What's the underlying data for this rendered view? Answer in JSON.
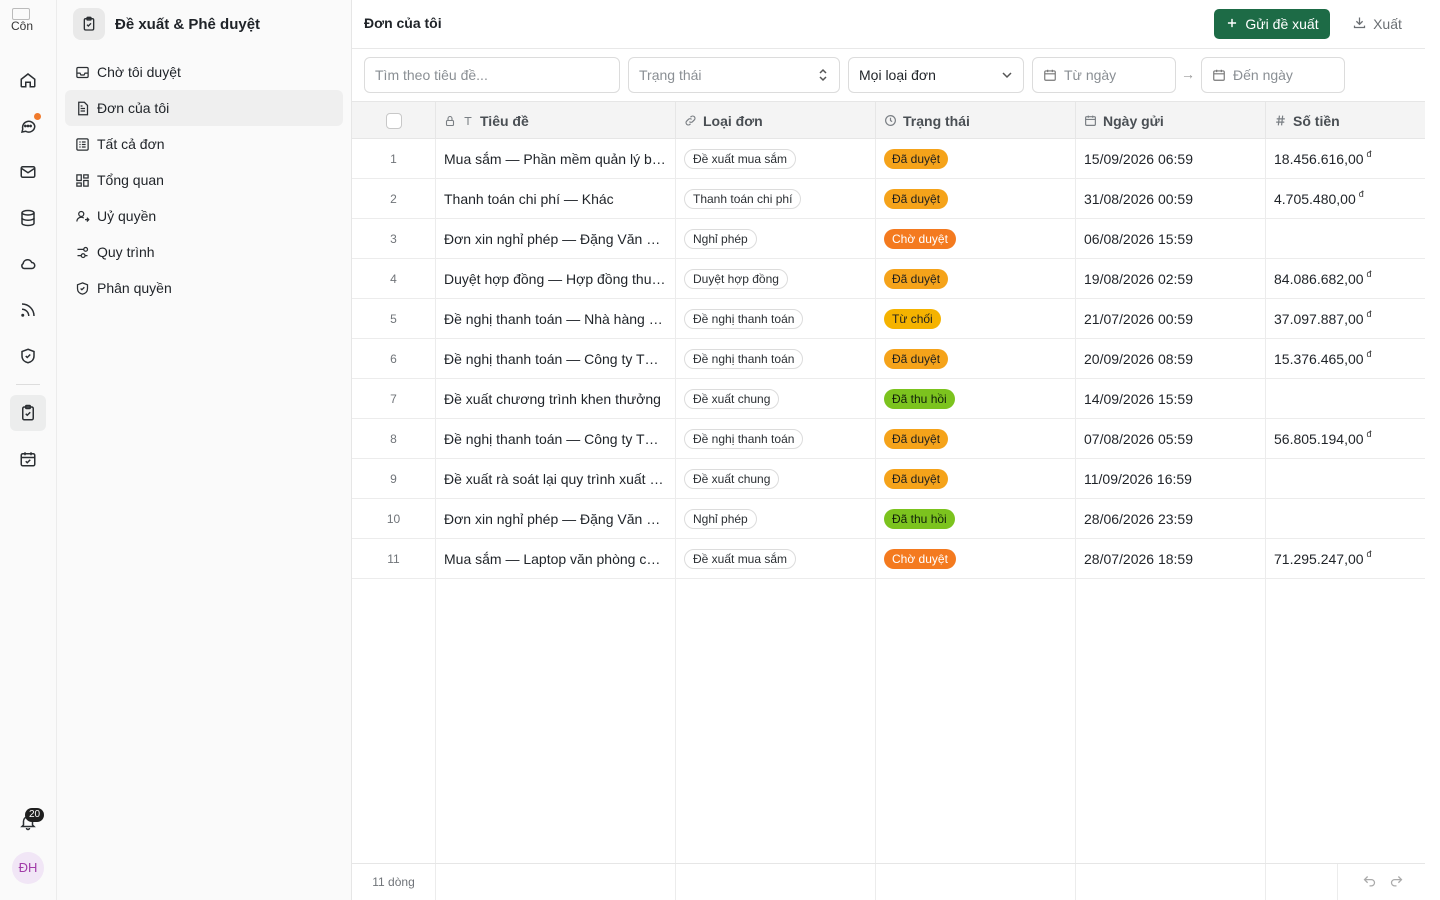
{
  "rail": {
    "logo_text": "Côn",
    "notification_count": "20",
    "avatar_initials": "ĐH"
  },
  "sidebar": {
    "title": "Đề xuất & Phê duyệt",
    "items": [
      {
        "label": "Chờ tôi duyệt",
        "icon": "inbox-icon"
      },
      {
        "label": "Đơn của tôi",
        "icon": "document-icon"
      },
      {
        "label": "Tất cả đơn",
        "icon": "list-icon"
      },
      {
        "label": "Tổng quan",
        "icon": "dashboard-icon"
      },
      {
        "label": "Uỷ quyền",
        "icon": "user-delegate-icon"
      },
      {
        "label": "Quy trình",
        "icon": "workflow-icon"
      },
      {
        "label": "Phân quyền",
        "icon": "shield-icon"
      }
    ],
    "active_index": 1
  },
  "header": {
    "title": "Đơn của tôi",
    "submit_label": "Gửi đề xuất",
    "export_label": "Xuất"
  },
  "filters": {
    "search_placeholder": "Tìm theo tiêu đề...",
    "status_placeholder": "Trạng thái",
    "type_value": "Mọi loại đơn",
    "from_placeholder": "Từ ngày",
    "to_placeholder": "Đến ngày",
    "range_arrow": "→"
  },
  "table": {
    "columns": [
      "Tiêu đề",
      "Loại đơn",
      "Trạng thái",
      "Ngày gửi",
      "Số tiền"
    ],
    "currency_symbol": "đ",
    "rows": [
      {
        "no": "1",
        "title": "Mua sắm — Phần mềm quản lý bán hàng",
        "type": "Đề xuất mua sắm",
        "status": "Đã duyệt",
        "status_kind": "approved",
        "date": "15/09/2026 06:59",
        "amount": "18.456.616,00"
      },
      {
        "no": "2",
        "title": "Thanh toán chi phí — Khác",
        "type": "Thanh toán chi phí",
        "status": "Đã duyệt",
        "status_kind": "approved",
        "date": "31/08/2026 00:59",
        "amount": "4.705.480,00"
      },
      {
        "no": "3",
        "title": "Đơn xin nghỉ phép — Đặng Văn Hùng",
        "type": "Nghỉ phép",
        "status": "Chờ duyệt",
        "status_kind": "pending",
        "date": "06/08/2026 15:59",
        "amount": ""
      },
      {
        "no": "4",
        "title": "Duyệt hợp đồng — Hợp đồng thuê văn phòng",
        "type": "Duyệt hợp đồng",
        "status": "Đã duyệt",
        "status_kind": "approved",
        "date": "19/08/2026 02:59",
        "amount": "84.086.682,00"
      },
      {
        "no": "5",
        "title": "Đề nghị thanh toán — Nhà hàng tiệc",
        "type": "Đề nghị thanh toán",
        "status": "Từ chối",
        "status_kind": "rejected",
        "date": "21/07/2026 00:59",
        "amount": "37.097.887,00"
      },
      {
        "no": "6",
        "title": "Đề nghị thanh toán — Công ty TNHH",
        "type": "Đề nghị thanh toán",
        "status": "Đã duyệt",
        "status_kind": "approved",
        "date": "20/09/2026 08:59",
        "amount": "15.376.465,00"
      },
      {
        "no": "7",
        "title": "Đề xuất chương trình khen thưởng",
        "type": "Đề xuất chung",
        "status": "Đã thu hồi",
        "status_kind": "withdrawn",
        "date": "14/09/2026 15:59",
        "amount": ""
      },
      {
        "no": "8",
        "title": "Đề nghị thanh toán — Công ty TNHH",
        "type": "Đề nghị thanh toán",
        "status": "Đã duyệt",
        "status_kind": "approved",
        "date": "07/08/2026 05:59",
        "amount": "56.805.194,00"
      },
      {
        "no": "9",
        "title": "Đề xuất rà soát lại quy trình xuất kho",
        "type": "Đề xuất chung",
        "status": "Đã duyệt",
        "status_kind": "approved",
        "date": "11/09/2026 16:59",
        "amount": ""
      },
      {
        "no": "10",
        "title": "Đơn xin nghỉ phép — Đặng Văn Hùng",
        "type": "Nghỉ phép",
        "status": "Đã thu hồi",
        "status_kind": "withdrawn",
        "date": "28/06/2026 23:59",
        "amount": ""
      },
      {
        "no": "11",
        "title": "Mua sắm — Laptop văn phòng cho nhân viên",
        "type": "Đề xuất mua sắm",
        "status": "Chờ duyệt",
        "status_kind": "pending",
        "date": "28/07/2026 18:59",
        "amount": "71.295.247,00"
      }
    ]
  },
  "footer": {
    "row_count": "11 dòng"
  }
}
